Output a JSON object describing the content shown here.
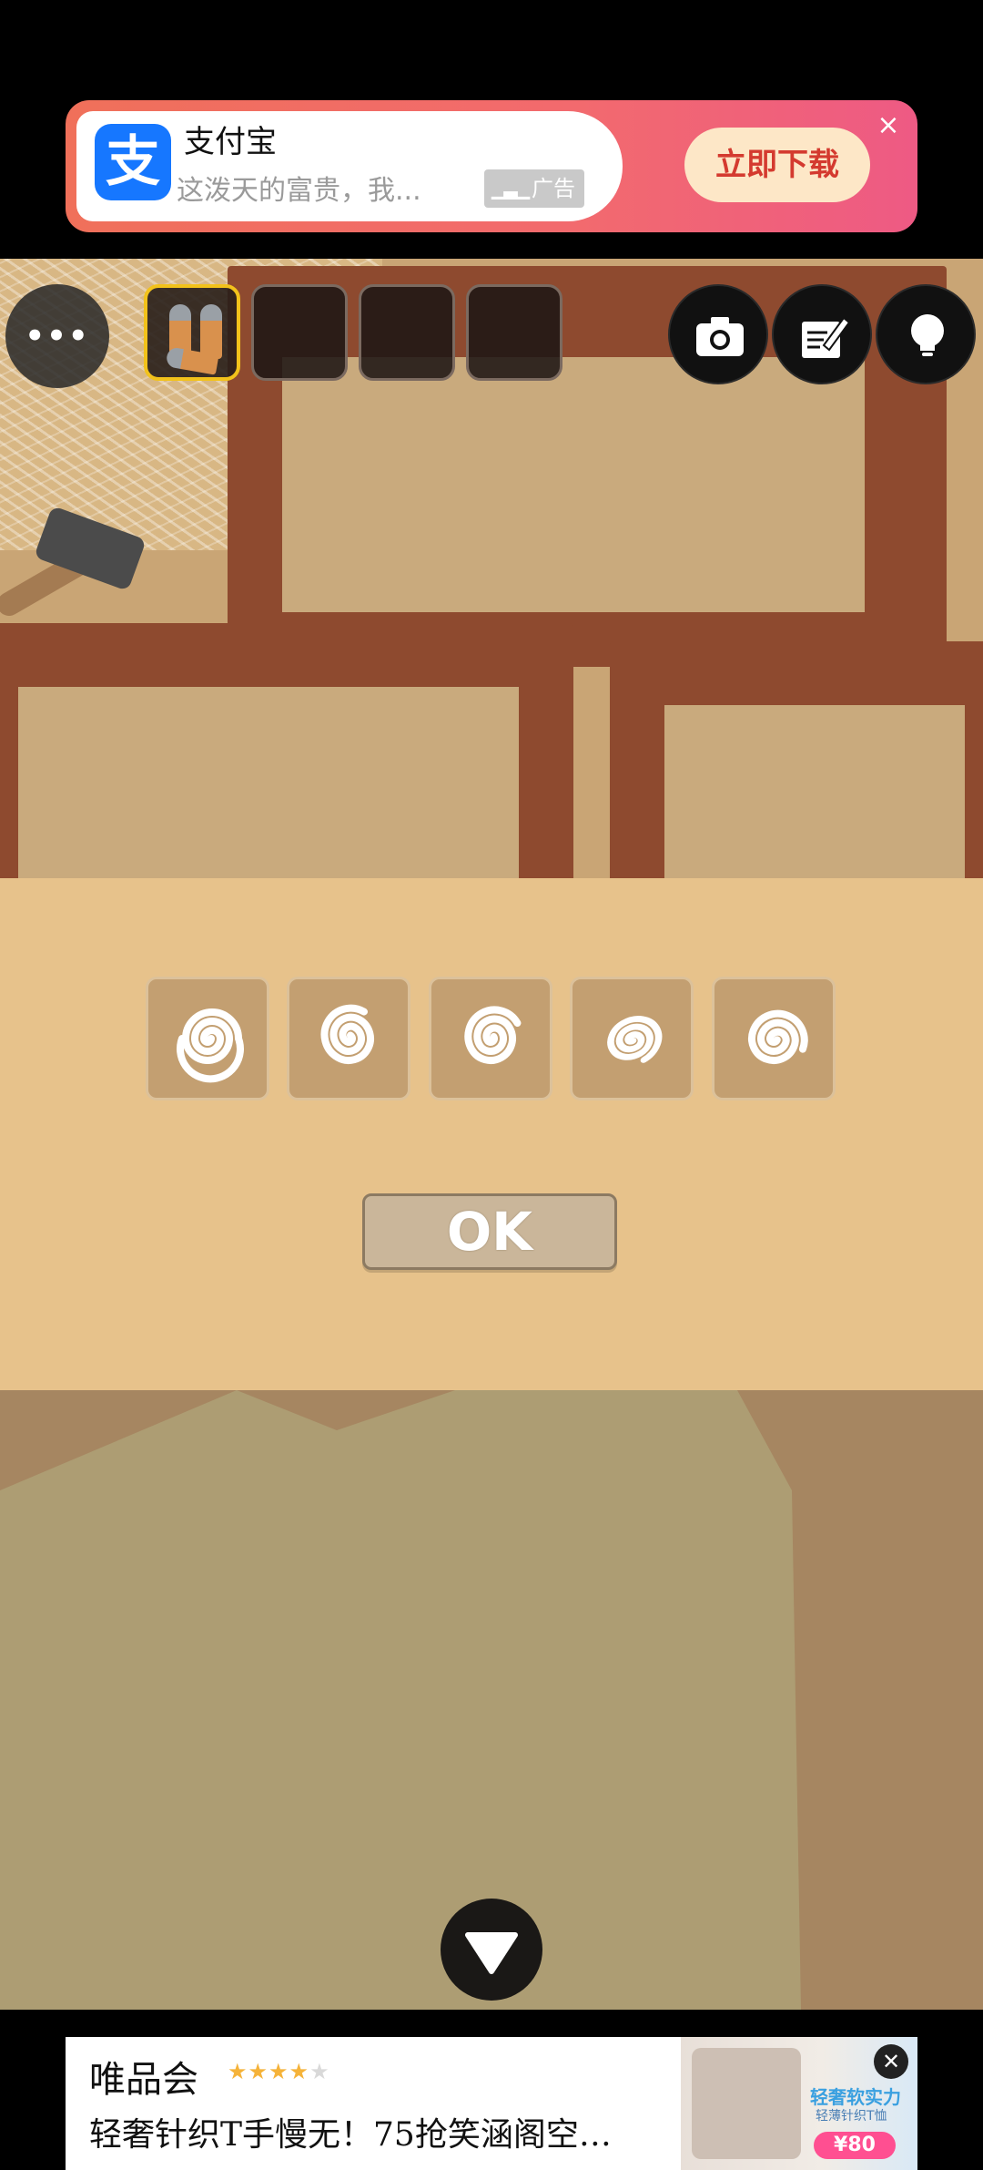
{
  "top_ad": {
    "app_name": "支付宝",
    "app_icon_glyph": "支",
    "description": "这泼天的富贵，我...",
    "ad_label": "广告",
    "download_label": "立即下载",
    "close_symbol": "×",
    "colors": {
      "accent": "#f26a6e",
      "icon": "#1677ff",
      "button_text": "#d43a2f"
    }
  },
  "toolbar": {
    "menu_label": "•••",
    "inventory_slots": [
      {
        "item": "bullets-icon",
        "selected": true
      },
      {
        "item": null,
        "selected": false
      },
      {
        "item": null,
        "selected": false
      },
      {
        "item": null,
        "selected": false
      }
    ],
    "buttons": [
      "camera-icon",
      "notepad-icon",
      "hint-lightbulb-icon"
    ]
  },
  "puzzle": {
    "tiles": [
      {
        "icon": "spiral-icon",
        "rotation": 0
      },
      {
        "icon": "spiral-icon",
        "rotation": 300
      },
      {
        "icon": "spiral-icon",
        "rotation": 330
      },
      {
        "icon": "spiral-icon",
        "rotation": 60
      },
      {
        "icon": "spiral-icon",
        "rotation": 20
      }
    ],
    "ok_label": "OK",
    "colors": {
      "panel": "#e7c28b",
      "tile": "#c39f71"
    }
  },
  "navigation": {
    "down_icon": "triangle-down-icon"
  },
  "bottom_ad": {
    "brand": "唯品会",
    "rating": 4,
    "rating_max": 5,
    "headline": "轻奢针织T手慢无！75抢笑涵阁空…",
    "thumb_promo": "轻奢软实力",
    "thumb_promo_sub": "轻薄针织T恤",
    "thumb_price": "¥80",
    "close_symbol": "✕"
  }
}
